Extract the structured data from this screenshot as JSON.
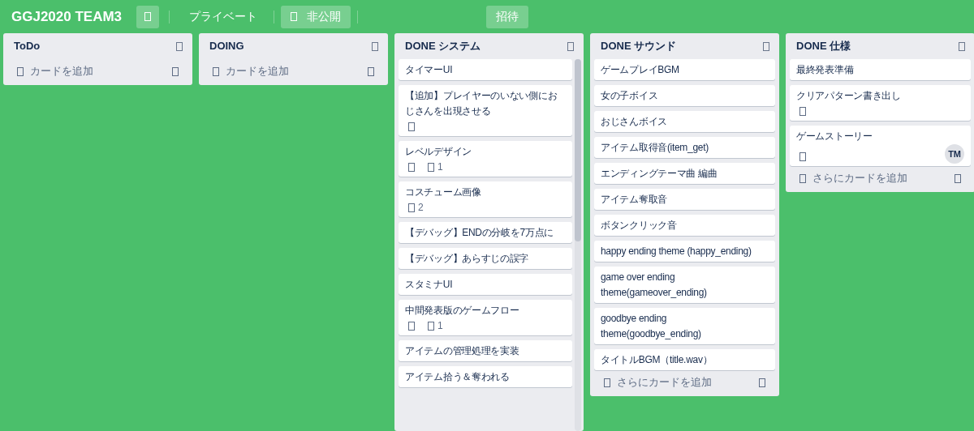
{
  "board": {
    "title": "GGJ2020 TEAM3",
    "visibility": "プライベート",
    "status": "非公開",
    "invite": "招待"
  },
  "lists": [
    {
      "name": "ToDo",
      "add_label": "カードを追加"
    },
    {
      "name": "DOING",
      "add_label": "カードを追加"
    },
    {
      "name": "DONE システム",
      "scrolling": true,
      "cards": [
        {
          "title": "タイマーUI"
        },
        {
          "title": "【追加】プレイヤーのいない側におじさんを出現させる",
          "badges": [
            {
              "kind": "plain"
            }
          ]
        },
        {
          "title": "レベルデザイン",
          "badges": [
            {
              "kind": "plain"
            },
            {
              "kind": "counter",
              "count": "1"
            }
          ]
        },
        {
          "title": "コスチューム画像",
          "badges": [
            {
              "kind": "counter",
              "count": "2"
            }
          ]
        },
        {
          "title": "【デバッグ】ENDの分岐を7万点に"
        },
        {
          "title": "【デバッグ】あらすじの誤字"
        },
        {
          "title": "スタミナUI"
        },
        {
          "title": "中間発表版のゲームフロー",
          "badges": [
            {
              "kind": "plain"
            },
            {
              "kind": "counter",
              "count": "1"
            }
          ]
        },
        {
          "title": "アイテムの管理処理を実装"
        },
        {
          "title": "アイテム拾う＆奪われる"
        }
      ]
    },
    {
      "name": "DONE サウンド",
      "add_label": "さらにカードを追加",
      "cards": [
        {
          "title": "ゲームプレイBGM"
        },
        {
          "title": "女の子ボイス"
        },
        {
          "title": "おじさんボイス"
        },
        {
          "title": "アイテム取得音(item_get)"
        },
        {
          "title": "エンディングテーマ曲 編曲"
        },
        {
          "title": "アイテム奪取音"
        },
        {
          "title": "ボタンクリック音"
        },
        {
          "title": "happy ending theme (happy_ending)"
        },
        {
          "title": "game over ending theme(gameover_ending)"
        },
        {
          "title": "goodbye ending theme(goodbye_ending)"
        },
        {
          "title": "タイトルBGM（title.wav）"
        }
      ]
    },
    {
      "name": "DONE 仕様",
      "add_label": "さらにカードを追加",
      "cards": [
        {
          "title": "最終発表準備"
        },
        {
          "title": "クリアパターン書き出し",
          "badges": [
            {
              "kind": "plain"
            }
          ]
        },
        {
          "title": "ゲームストーリー",
          "badges": [
            {
              "kind": "plain"
            }
          ],
          "member": "TM"
        }
      ]
    }
  ]
}
